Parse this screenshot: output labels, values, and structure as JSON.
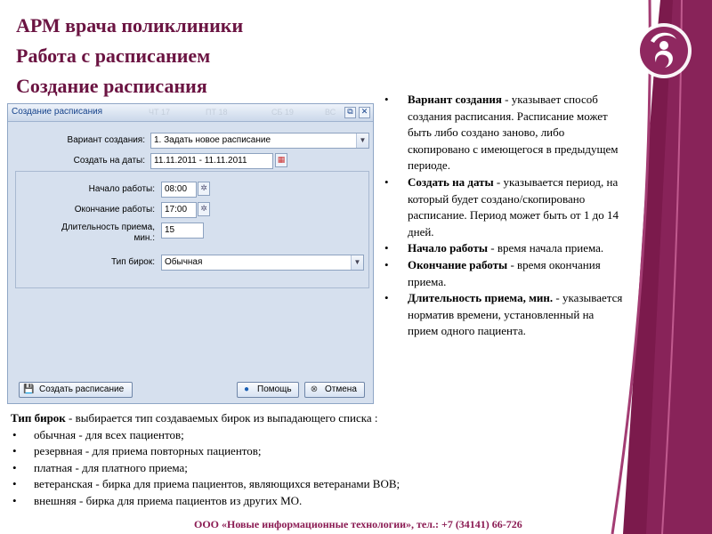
{
  "slide": {
    "title_lines": [
      "АРМ врача поликлиники",
      "Работа с расписанием",
      "Создание расписания"
    ],
    "footer": "ООО «Новые информационные технологии», тел.: +7 (34141) 66-726"
  },
  "dialog": {
    "title": "Создание расписания",
    "bg_headers": [
      "ЧТ 17",
      "ПТ 18",
      "СБ 19",
      "ВС"
    ],
    "fields": {
      "variant": {
        "label": "Вариант создания:",
        "value": "1. Задать новое расписание"
      },
      "dates": {
        "label": "Создать на даты:",
        "value": "11.11.2011 - 11.11.2011"
      },
      "start": {
        "label": "Начало работы:",
        "value": "08:00"
      },
      "end": {
        "label": "Окончание работы:",
        "value": "17:00"
      },
      "duration": {
        "label_line1": "Длительность приема,",
        "label_line2": "мин.:",
        "value": "15"
      },
      "tag_type": {
        "label": "Тип бирок:",
        "value": "Обычная"
      }
    },
    "buttons": {
      "create": "Создать расписание",
      "help": "Помощь",
      "cancel": "Отмена"
    }
  },
  "description": [
    {
      "term": "Вариант создания",
      "text": " - указывает способ создания расписания. Расписание может быть либо создано заново, либо скопировано с имеющегося в предыдущем периоде."
    },
    {
      "term": "Создать на даты",
      "text": " - указывается период, на который будет создано/скопировано расписание. Период может быть от 1 до 14 дней."
    },
    {
      "term": "Начало работы",
      "text": " - время начала приема."
    },
    {
      "term": "Окончание работы",
      "text": " - время окончания приема."
    },
    {
      "term": "Длительность приема, мин.",
      "text": " - указывается норматив времени, установленный на прием одного пациента."
    }
  ],
  "tag_types": {
    "intro_term": "Тип бирок",
    "intro_text": " - выбирается тип создаваемых бирок из выпадающего списка :",
    "items": [
      "обычная - для всех пациентов;",
      "резервная - для приема повторных пациентов;",
      "платная - для платного приема;",
      "ветеранская - бирка для приема пациентов, являющихся ветеранами ВОВ;",
      "внешняя - бирка для приема пациентов из других МО."
    ]
  },
  "colors": {
    "brand": "#8a1a52",
    "title": "#6b1442",
    "dialog_bg": "#d6e0ee",
    "dialog_title": "#15428b"
  }
}
